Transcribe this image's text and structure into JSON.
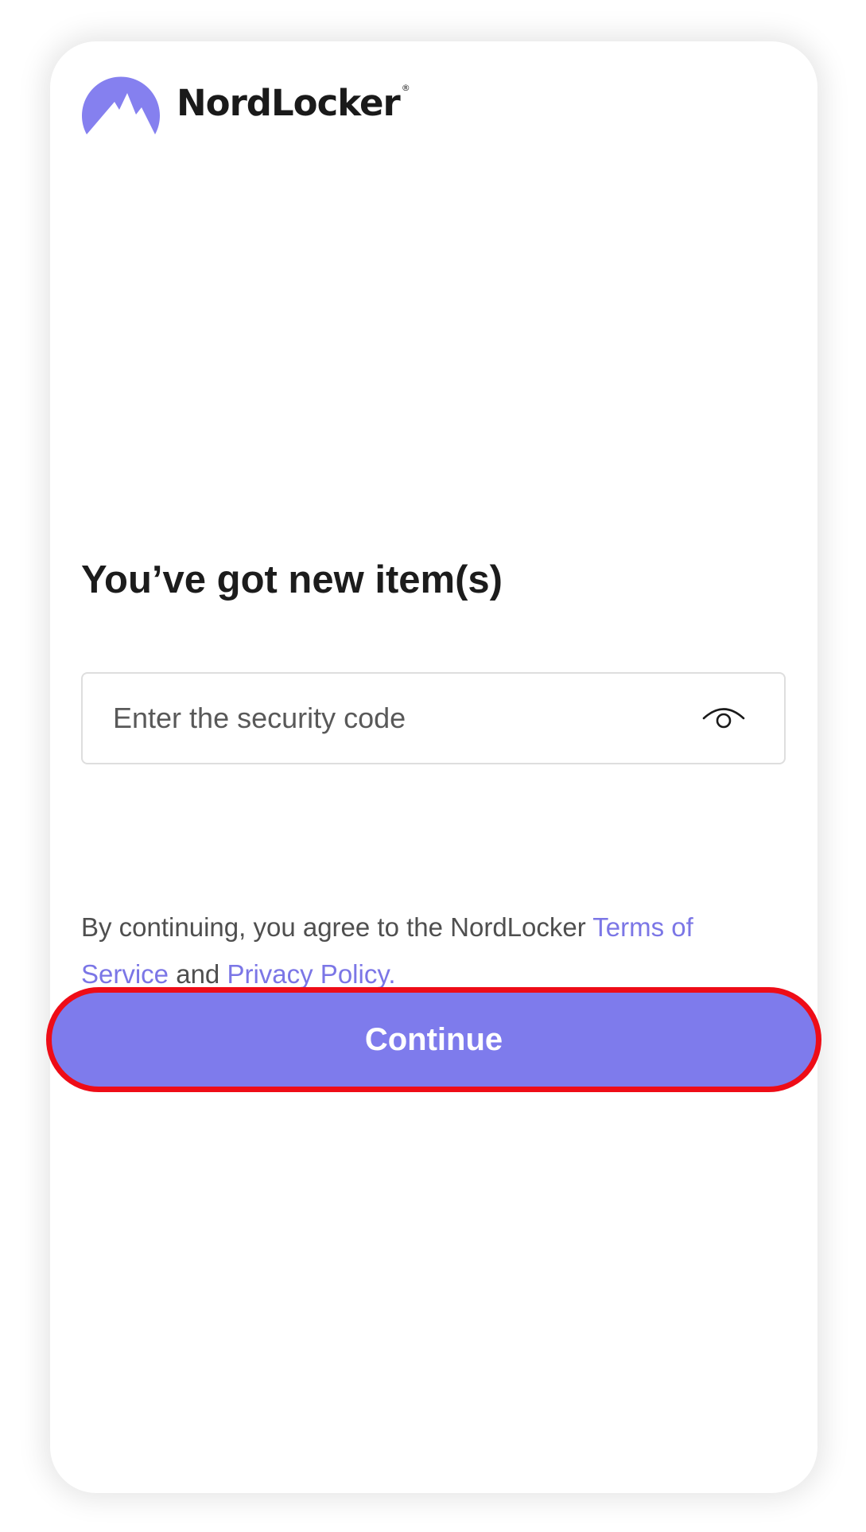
{
  "brand": {
    "name": "NordLocker",
    "registered_mark": "®",
    "logo_icon": "nordlocker-mountain-logo-icon",
    "accent_color": "#7e7bec"
  },
  "title": "You’ve got new item(s)",
  "security_code": {
    "placeholder": "Enter the security code",
    "value": "",
    "visibility_icon": "eye-icon"
  },
  "terms": {
    "prefix": "By continuing, you agree to the NordLocker ",
    "terms_link": "Terms of Service",
    "conjunction": " and ",
    "privacy_link": "Privacy Policy."
  },
  "continue_button": {
    "label": "Continue",
    "highlight_color": "#ee0c17"
  }
}
